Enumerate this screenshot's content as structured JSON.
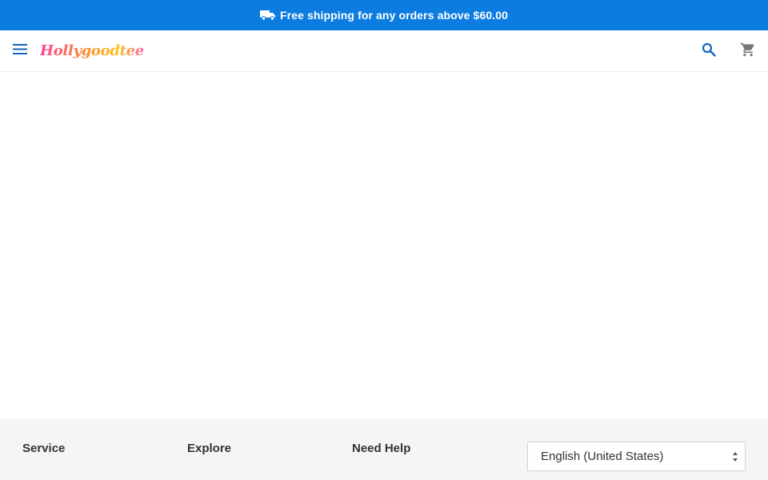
{
  "promo": {
    "icon": "truck-icon",
    "text": "Free shipping for any orders above $60.00"
  },
  "header": {
    "menu_icon": "menu-icon",
    "logo_text": "Hollygoodtee",
    "search_icon": "search-icon",
    "cart_icon": "cart-icon"
  },
  "footer": {
    "columns": [
      {
        "label": "Service"
      },
      {
        "label": "Explore"
      },
      {
        "label": "Need Help"
      }
    ],
    "language_select": {
      "selected": "English (United States)"
    }
  },
  "colors": {
    "promo_bg": "#0c7ce0",
    "icon_blue": "#1565c0",
    "icon_gray": "#777777",
    "footer_bg": "#f5f5f5"
  }
}
